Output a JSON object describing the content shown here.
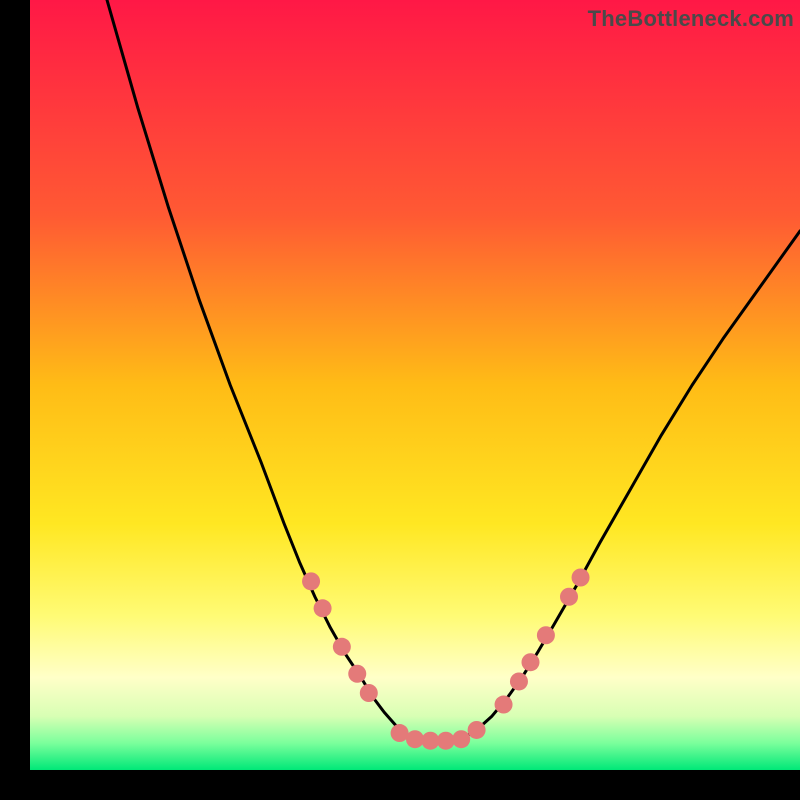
{
  "watermark": "TheBottleneck.com",
  "chart_data": {
    "type": "line",
    "title": "",
    "xlabel": "",
    "ylabel": "",
    "xlim": [
      0,
      100
    ],
    "ylim": [
      0,
      100
    ],
    "grid": false,
    "legend": false,
    "background_gradient_stops": [
      {
        "offset": 0.0,
        "color": "#ff1846"
      },
      {
        "offset": 0.28,
        "color": "#ff5a33"
      },
      {
        "offset": 0.5,
        "color": "#ffbc16"
      },
      {
        "offset": 0.68,
        "color": "#ffe722"
      },
      {
        "offset": 0.8,
        "color": "#fffb75"
      },
      {
        "offset": 0.88,
        "color": "#ffffc8"
      },
      {
        "offset": 0.93,
        "color": "#d8ffb4"
      },
      {
        "offset": 0.965,
        "color": "#7bff9c"
      },
      {
        "offset": 1.0,
        "color": "#00e878"
      }
    ],
    "series": [
      {
        "name": "left-curve",
        "stroke": "#000000",
        "x": [
          10,
          14,
          18,
          22,
          26,
          30,
          33,
          35,
          37,
          39,
          41,
          43,
          44.5,
          46,
          47.5,
          49,
          50
        ],
        "y": [
          100,
          86,
          73,
          61,
          50,
          40,
          32,
          27,
          22.5,
          18.5,
          15,
          12,
          9.5,
          7.5,
          5.8,
          4.5,
          4
        ]
      },
      {
        "name": "flat-bottom",
        "stroke": "#000000",
        "x": [
          50,
          52,
          54,
          56
        ],
        "y": [
          4,
          3.8,
          3.8,
          4
        ]
      },
      {
        "name": "right-curve",
        "stroke": "#000000",
        "x": [
          56,
          58,
          60,
          62,
          64,
          66,
          68,
          71,
          74,
          78,
          82,
          86,
          90,
          95,
          100
        ],
        "y": [
          4,
          5.2,
          7,
          9.4,
          12.2,
          15.4,
          18.8,
          24,
          29.5,
          36.5,
          43.5,
          50,
          56,
          63,
          70
        ]
      }
    ],
    "markers": {
      "color": "#e47a79",
      "radius_px": 9,
      "points": [
        {
          "x": 36.5,
          "y": 24.5
        },
        {
          "x": 38.0,
          "y": 21.0
        },
        {
          "x": 40.5,
          "y": 16.0
        },
        {
          "x": 42.5,
          "y": 12.5
        },
        {
          "x": 44.0,
          "y": 10.0
        },
        {
          "x": 48.0,
          "y": 4.8
        },
        {
          "x": 50.0,
          "y": 4.0
        },
        {
          "x": 52.0,
          "y": 3.8
        },
        {
          "x": 54.0,
          "y": 3.8
        },
        {
          "x": 56.0,
          "y": 4.0
        },
        {
          "x": 58.0,
          "y": 5.2
        },
        {
          "x": 61.5,
          "y": 8.5
        },
        {
          "x": 63.5,
          "y": 11.5
        },
        {
          "x": 65.0,
          "y": 14.0
        },
        {
          "x": 67.0,
          "y": 17.5
        },
        {
          "x": 70.0,
          "y": 22.5
        },
        {
          "x": 71.5,
          "y": 25.0
        }
      ]
    }
  }
}
